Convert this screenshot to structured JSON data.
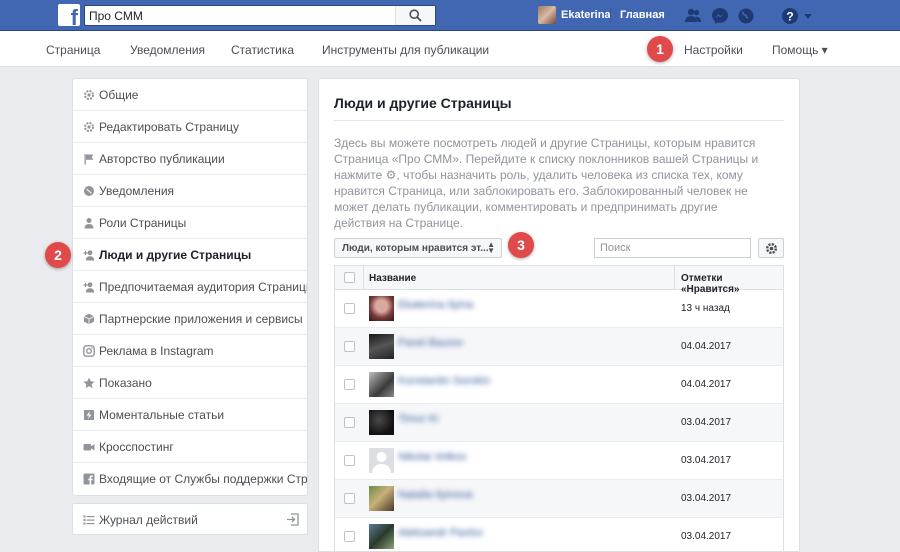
{
  "topbar": {
    "search_value": "Про СММ",
    "user_name": "Ekaterina",
    "home_label": "Главная",
    "icons": [
      "friends-icon",
      "messenger-icon",
      "globe-icon",
      "help-icon",
      "caret-down-icon"
    ],
    "bg_color": "#4267b2"
  },
  "pagenav": {
    "items": [
      "Страница",
      "Уведомления",
      "Статистика",
      "Инструменты для публикации"
    ],
    "settings": "Настройки",
    "help": "Помощь ▾"
  },
  "markers": [
    "1",
    "2",
    "3"
  ],
  "sidebar": {
    "items": [
      {
        "label": "Общие",
        "icon": "gear-icon"
      },
      {
        "label": "Редактировать Страницу",
        "icon": "gear-icon"
      },
      {
        "label": "Авторство публикации",
        "icon": "flag-icon"
      },
      {
        "label": "Уведомления",
        "icon": "globe-icon"
      },
      {
        "label": "Роли Страницы",
        "icon": "person-icon"
      },
      {
        "label": "Люди и другие Страницы",
        "icon": "person-plus-icon"
      },
      {
        "label": "Предпочитаемая аудитория Страницы",
        "icon": "person-plus-icon"
      },
      {
        "label": "Партнерские приложения и сервисы",
        "icon": "cube-icon"
      },
      {
        "label": "Реклама в Instagram",
        "icon": "instagram-icon"
      },
      {
        "label": "Показано",
        "icon": "star-icon"
      },
      {
        "label": "Моментальные статьи",
        "icon": "lightning-icon"
      },
      {
        "label": "Кросспостинг",
        "icon": "video-camera-icon"
      },
      {
        "label": "Входящие от Службы поддержки Стран",
        "icon": "facebook-icon"
      }
    ],
    "activity_log": "Журнал действий"
  },
  "main": {
    "title": "Люди и другие Страницы",
    "description": "Здесь вы можете посмотреть людей и другие Страницы, которым нравится Страница «Про СММ». Перейдите к списку поклонников вашей Страницы и нажмите ⚙, чтобы назначить роль, удалить человека из списка тех, кому нравится Страница, или заблокировать его. Заблокированный человек не может делать публикации, комментировать и предпринимать другие действия на Странице.",
    "filter_label": "Люди, которым нравится эт...",
    "search_placeholder": "Поиск",
    "table": {
      "col_name": "Название",
      "col_likes": "Отметки «Нравится»",
      "rows": [
        {
          "name": "Ekaterina Ilyina",
          "date": "13 ч назад"
        },
        {
          "name": "Pavel Baurov",
          "date": "04.04.2017"
        },
        {
          "name": "Konstantin Sorokin",
          "date": "04.04.2017"
        },
        {
          "name": "Timur Ki",
          "date": "03.04.2017"
        },
        {
          "name": "Nikolai Volkov",
          "date": "03.04.2017"
        },
        {
          "name": "Natalia Ilyinova",
          "date": "03.04.2017"
        },
        {
          "name": "Aleksandr Pavlov",
          "date": "03.04.2017"
        }
      ]
    }
  }
}
